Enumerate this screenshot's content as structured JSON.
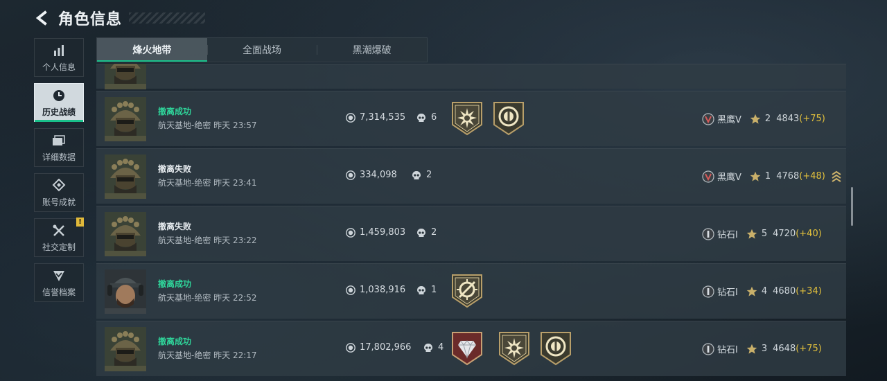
{
  "header": {
    "title": "角色信息"
  },
  "sidebar": {
    "items": [
      {
        "label": "个人信息",
        "icon": "bar-chart-icon"
      },
      {
        "label": "历史战绩",
        "icon": "clock-icon",
        "active": true
      },
      {
        "label": "详细数据",
        "icon": "cards-icon"
      },
      {
        "label": "账号成就",
        "icon": "achievement-icon"
      },
      {
        "label": "社交定制",
        "icon": "tools-icon",
        "badge": "!"
      },
      {
        "label": "信誉档案",
        "icon": "shield-check-icon"
      }
    ]
  },
  "tabs": [
    {
      "label": "烽火地带",
      "active": true
    },
    {
      "label": "全面战场"
    },
    {
      "label": "黑潮爆破"
    }
  ],
  "records": [
    {
      "status": "撤离成功",
      "status_type": "success",
      "map": "航天基地-绝密",
      "time": "昨天 23:57",
      "value": "7,314,535",
      "kills": "6",
      "medals": [
        "sun-emblem-icon",
        "wreath-emblem-icon"
      ],
      "rank_icon": "v-rank-icon",
      "rank": "黑鹰V",
      "stars": "2",
      "score": "4843",
      "delta": "(+75)"
    },
    {
      "status": "撤离失败",
      "status_type": "fail",
      "map": "航天基地-绝密",
      "time": "昨天 23:41",
      "value": "334,098",
      "kills": "2",
      "medals": [],
      "rank_icon": "v-rank-icon",
      "rank": "黑鹰V",
      "stars": "1",
      "score": "4768",
      "delta": "(+48)",
      "promo": true
    },
    {
      "status": "撤离失败",
      "status_type": "fail",
      "map": "航天基地-绝密",
      "time": "昨天 23:22",
      "value": "1,459,803",
      "kills": "2",
      "medals": [],
      "rank_icon": "i-rank-icon",
      "rank": "钻石I",
      "stars": "5",
      "score": "4720",
      "delta": "(+40)"
    },
    {
      "status": "撤离成功",
      "status_type": "success",
      "map": "航天基地-绝密",
      "time": "昨天 22:52",
      "value": "1,038,916",
      "kills": "1",
      "medals": [
        "crosshair-emblem-icon"
      ],
      "rank_icon": "i-rank-icon",
      "rank": "钻石I",
      "stars": "4",
      "score": "4680",
      "delta": "(+34)",
      "avatar": "cap"
    },
    {
      "status": "撤离成功",
      "status_type": "success",
      "map": "航天基地-绝密",
      "time": "昨天 22:17",
      "value": "17,802,966",
      "kills": "4",
      "medals": [
        "diamond-emblem-icon",
        "sun-emblem-icon",
        "wreath-emblem-icon"
      ],
      "rank_icon": "i-rank-icon",
      "rank": "钻石I",
      "stars": "3",
      "score": "4648",
      "delta": "(+75)"
    }
  ],
  "colors": {
    "success": "#2fd49a",
    "accent_green": "#19c08a",
    "delta": "#e3c13c",
    "badge": "#e0b93a"
  }
}
